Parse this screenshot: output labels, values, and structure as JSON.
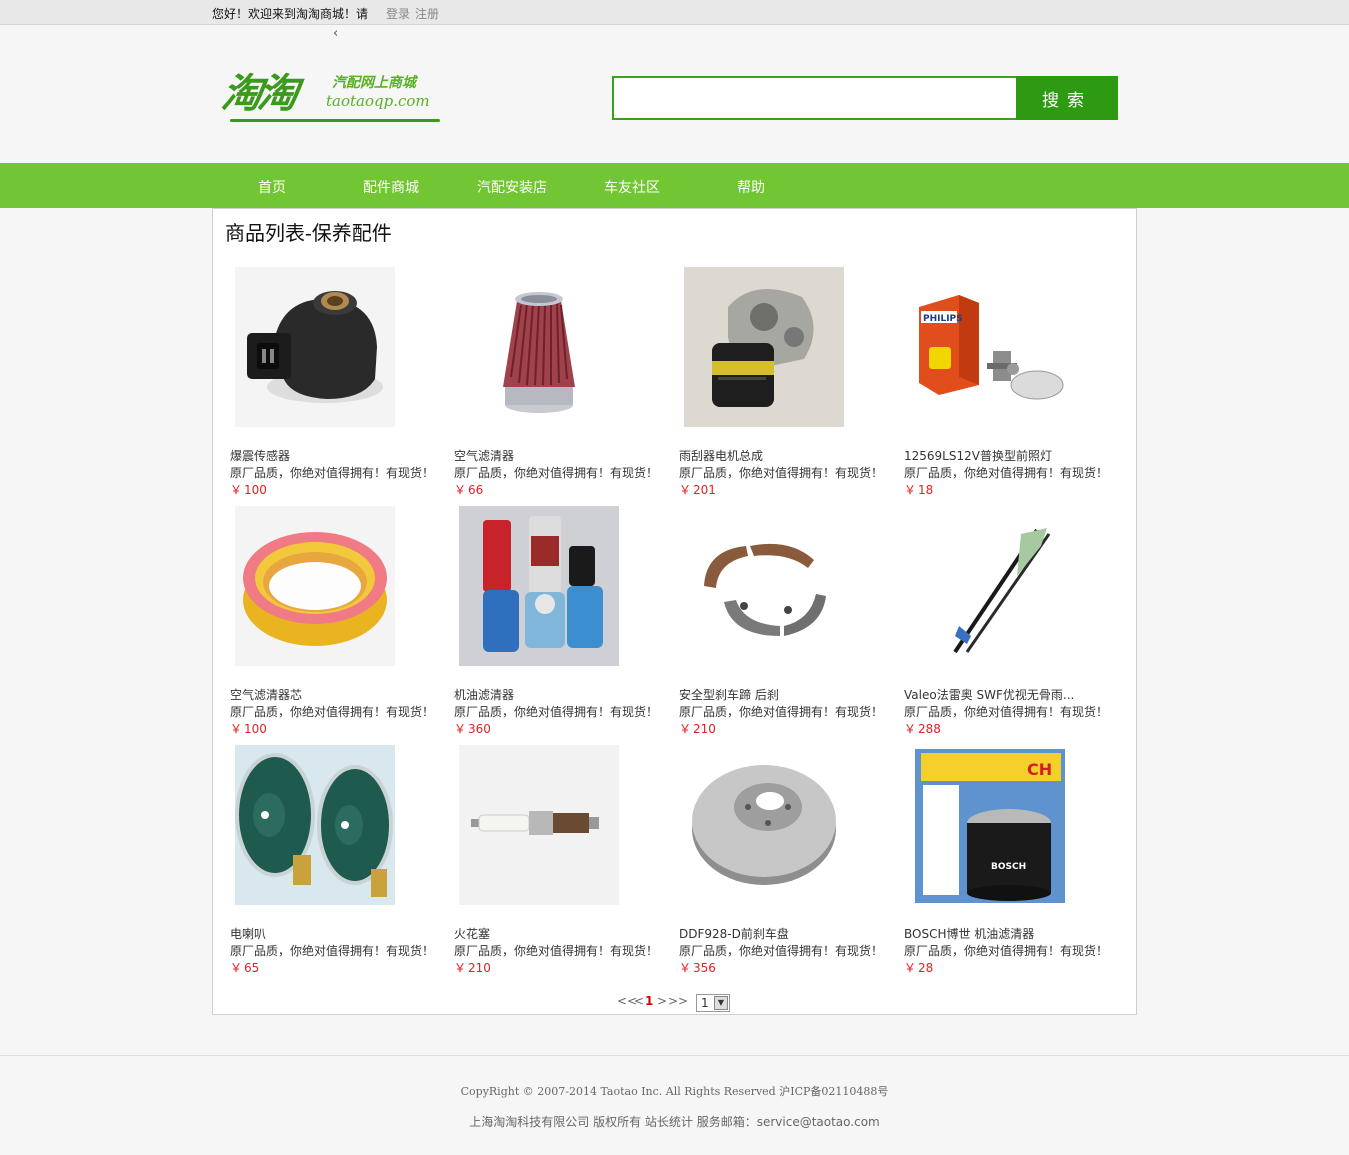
{
  "topbar": {
    "welcome": "您好！欢迎来到淘淘商城！请",
    "login": "登录",
    "register": "注册",
    "back": "‹"
  },
  "logo": {
    "cn": "淘淘",
    "sub": "汽配网上商城",
    "url": "taotaoqp.com"
  },
  "search": {
    "placeholder": "",
    "button": "搜索"
  },
  "nav": [
    "首页",
    "配件商城",
    "汽配安装店",
    "车友社区",
    "帮助"
  ],
  "page_title": "商品列表-保养配件",
  "currency": "￥",
  "products": [
    {
      "name": "爆震传感器",
      "desc": "原厂品质，你绝对值得拥有！有现货！",
      "price": "100",
      "icon": "knock-sensor"
    },
    {
      "name": "空气滤清器",
      "desc": "原厂品质，你绝对值得拥有！有现货！",
      "price": "66",
      "icon": "air-filter-cone"
    },
    {
      "name": "雨刮器电机总成",
      "desc": "原厂品质，你绝对值得拥有！有现货！",
      "price": "201",
      "icon": "wiper-motor"
    },
    {
      "name": "12569LS12V普换型前照灯",
      "desc": "原厂品质，你绝对值得拥有！有现货！",
      "price": "18",
      "icon": "headlight-bulb"
    },
    {
      "name": "空气滤清器芯",
      "desc": "原厂品质，你绝对值得拥有！有现货！",
      "price": "100",
      "icon": "air-filter-ring"
    },
    {
      "name": "机油滤清器",
      "desc": "原厂品质，你绝对值得拥有！有现货！",
      "price": "360",
      "icon": "oil-filters"
    },
    {
      "name": "安全型刹车蹄 后刹",
      "desc": "原厂品质，你绝对值得拥有！有现货！",
      "price": "210",
      "icon": "brake-shoes"
    },
    {
      "name": "Valeo法雷奥 SWF优视无骨雨...",
      "desc": "原厂品质，你绝对值得拥有！有现货！",
      "price": "288",
      "icon": "wiper-blade"
    },
    {
      "name": "电喇叭",
      "desc": "原厂品质，你绝对值得拥有！有现货！",
      "price": "65",
      "icon": "electric-horn"
    },
    {
      "name": "火花塞",
      "desc": "原厂品质，你绝对值得拥有！有现货！",
      "price": "210",
      "icon": "spark-plug"
    },
    {
      "name": "DDF928-D前刹车盘",
      "desc": "原厂品质，你绝对值得拥有！有现货！",
      "price": "356",
      "icon": "brake-disc"
    },
    {
      "name": "BOSCH博世 机油滤清器",
      "desc": "原厂品质，你绝对值得拥有！有现货！",
      "price": "28",
      "icon": "bosch-oil-filter"
    }
  ],
  "pager": {
    "first": "<<",
    "prev": "<",
    "current": "1",
    "next": ">",
    "last": ">>",
    "select_value": "1"
  },
  "footer": {
    "copyright": "CopyRight © 2007-2014 Taotao Inc. All Rights Reserved 沪ICP备02110488号",
    "company": "上海淘淘科技有限公司 版权所有 站长统计 服务邮箱：service@taotao.com"
  },
  "colors": {
    "nav_green": "#72c633",
    "search_green": "#2e9a12",
    "price_red": "#d22"
  }
}
